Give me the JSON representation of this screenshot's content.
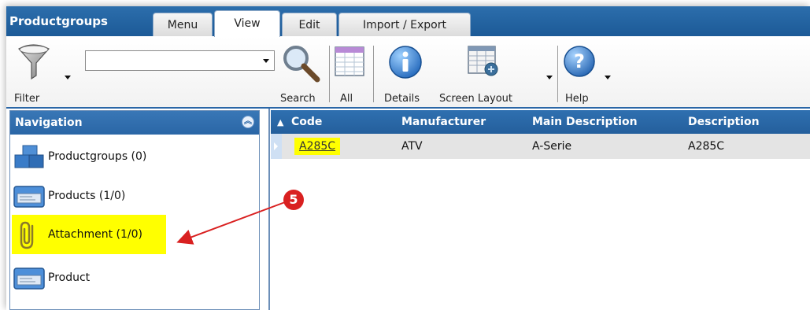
{
  "app_title": "Productgroups",
  "tabs": [
    {
      "label": "Menu",
      "active": false
    },
    {
      "label": "View",
      "active": true
    },
    {
      "label": "Edit",
      "active": false
    },
    {
      "label": "Import / Export",
      "active": false
    }
  ],
  "toolbar": {
    "filter_label": "Filter",
    "search_value": "",
    "search_label": "Search",
    "all_label": "All",
    "details_label": "Details",
    "screen_layout_label": "Screen Layout",
    "help_label": "Help"
  },
  "navigation": {
    "title": "Navigation",
    "items": [
      {
        "label": "Productgroups (0)",
        "icon": "productgroups-icon"
      },
      {
        "label": "Products (1/0)",
        "icon": "products-icon"
      },
      {
        "label": "Attachment (1/0)",
        "icon": "paperclip-icon",
        "highlighted": true
      },
      {
        "label": "Product",
        "icon": "product-icon"
      }
    ]
  },
  "grid": {
    "sort_indicator": "▲",
    "columns": [
      "Code",
      "Manufacturer",
      "Main Description",
      "Description"
    ],
    "rows": [
      {
        "code": "A285C",
        "manufacturer": "ATV",
        "main_description": "A-Serie",
        "description": "A285C"
      }
    ]
  },
  "annotation": {
    "number": "5"
  },
  "colors": {
    "header_blue": "#2a66a6",
    "highlight": "#ffff00",
    "annotation_red": "#d92020"
  }
}
